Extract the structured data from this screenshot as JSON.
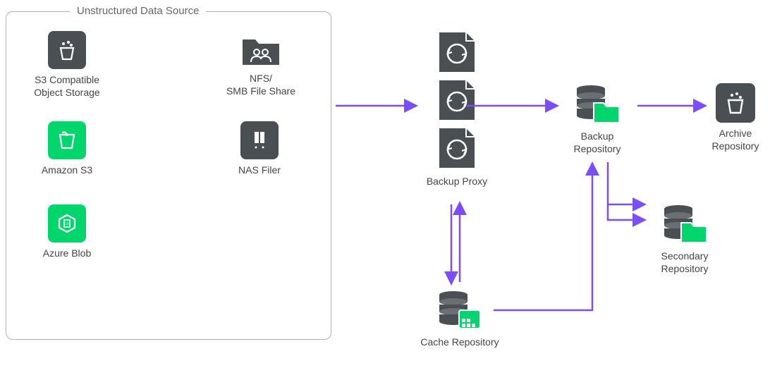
{
  "group": {
    "title": "Unstructured Data Source"
  },
  "nodes": {
    "s3compat": "S3 Compatible\nObject Storage",
    "amazons3": "Amazon S3",
    "azureblob": "Azure Blob",
    "nfs": "NFS/\nSMB File Share",
    "nasfiler": "NAS Filer",
    "backupproxy": "Backup Proxy",
    "backuprepo": "Backup\nRepository",
    "archiverepo": "Archive\nRepository",
    "secondaryrepo": "Secondary\nRepository",
    "cacherepo": "Cache Repository"
  },
  "colors": {
    "arrow": "#7c4dff",
    "dark": "#4a4f54",
    "green": "#00d66c"
  }
}
